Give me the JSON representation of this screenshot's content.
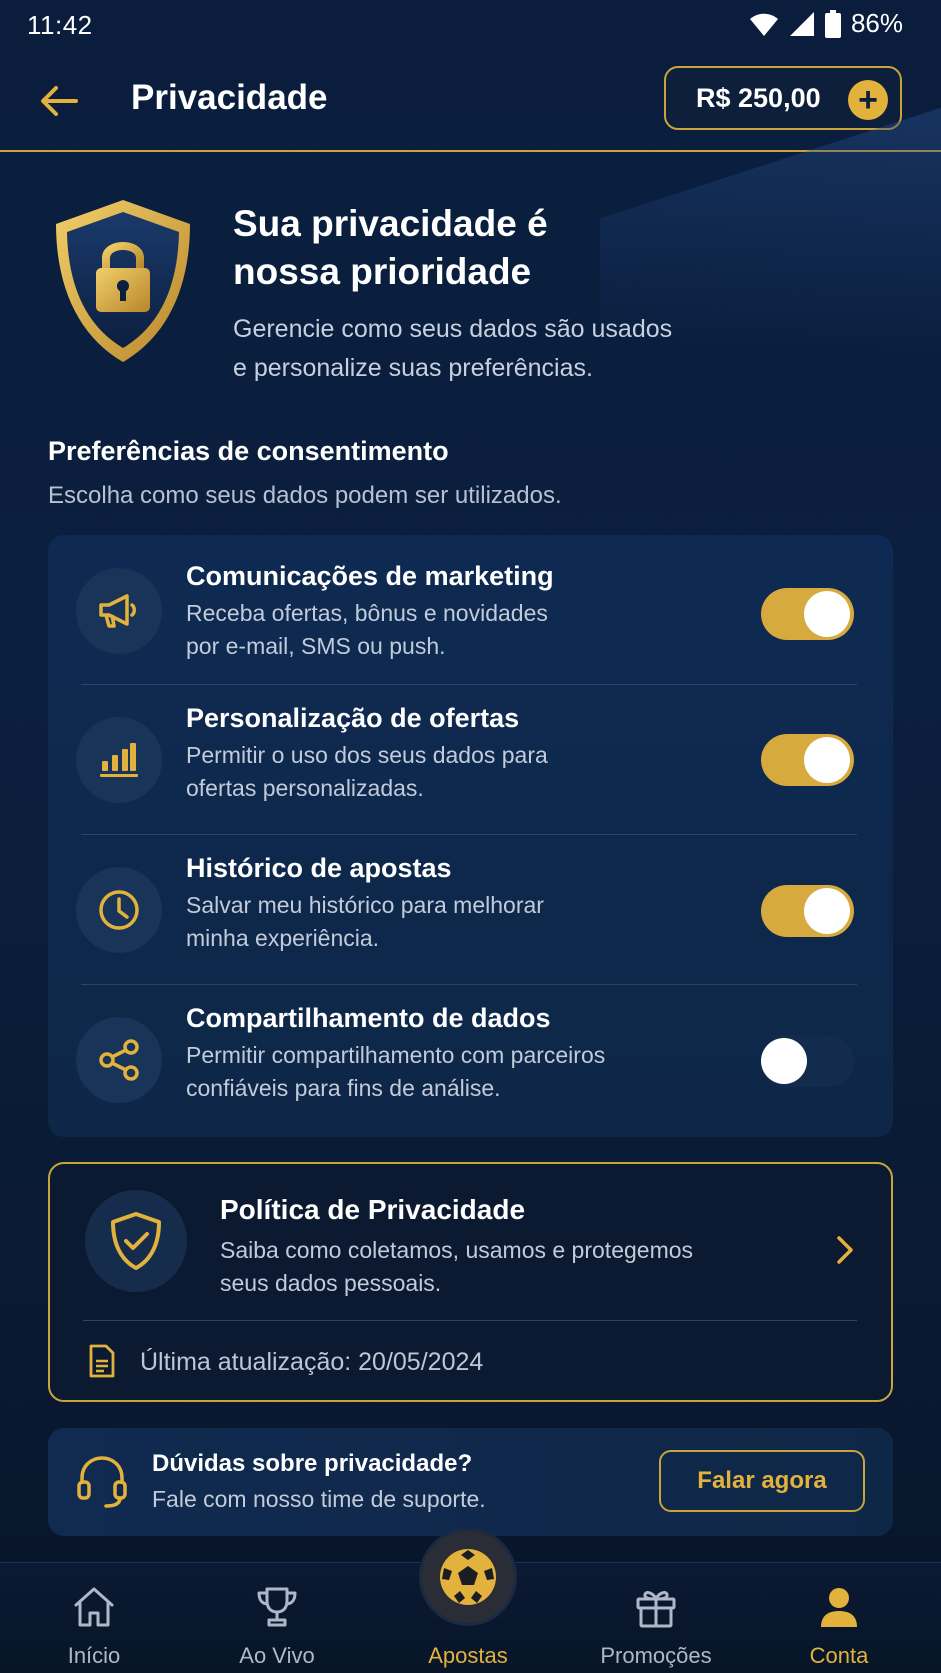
{
  "status_bar": {
    "time": "11:42",
    "battery": "86%"
  },
  "header": {
    "title": "Privacidade",
    "balance": "R$ 250,00",
    "add_symbol": "+"
  },
  "hero": {
    "title_line1": "Sua privacidade é",
    "title_line2": "nossa prioridade",
    "subtitle_line1": "Gerencie como seus dados são usados",
    "subtitle_line2": "e personalize suas preferências."
  },
  "consent": {
    "title": "Preferências de consentimento",
    "subtitle": "Escolha como seus dados podem ser utilizados.",
    "items": [
      {
        "title": "Comunicações de marketing",
        "desc_line1": "Receba ofertas, bônus e novidades",
        "desc_line2": "por e-mail, SMS ou push.",
        "icon": "megaphone-icon",
        "enabled": true
      },
      {
        "title": "Personalização de ofertas",
        "desc_line1": "Permitir o uso dos seus dados para",
        "desc_line2": "ofertas personalizadas.",
        "icon": "bar-chart-icon",
        "enabled": true
      },
      {
        "title": "Histórico de apostas",
        "desc_line1": "Salvar meu histórico para melhorar",
        "desc_line2": "minha experiência.",
        "icon": "clock-icon",
        "enabled": true
      },
      {
        "title": "Compartilhamento de dados",
        "desc_line1": "Permitir compartilhamento com parceiros",
        "desc_line2": "confiáveis para fins de análise.",
        "icon": "share-icon",
        "enabled": false
      }
    ]
  },
  "policy": {
    "title": "Política de Privacidade",
    "desc_line1": "Saiba como coletamos, usamos e protegemos",
    "desc_line2": "seus dados pessoais.",
    "updated": "Última atualização: 20/05/2024"
  },
  "support": {
    "title": "Dúvidas sobre privacidade?",
    "subtitle": "Fale com nosso time de suporte.",
    "button": "Falar agora"
  },
  "nav": {
    "items": [
      {
        "label": "Início",
        "icon": "home-icon"
      },
      {
        "label": "Ao Vivo",
        "icon": "trophy-icon"
      },
      {
        "label": "Apostas",
        "icon": "soccer-ball-icon"
      },
      {
        "label": "Promoções",
        "icon": "gift-icon"
      },
      {
        "label": "Conta",
        "icon": "user-icon"
      }
    ],
    "active": "Conta"
  },
  "colors": {
    "accent": "#e3b23c",
    "background": "#0a1d3d",
    "card": "#0f2a52"
  }
}
